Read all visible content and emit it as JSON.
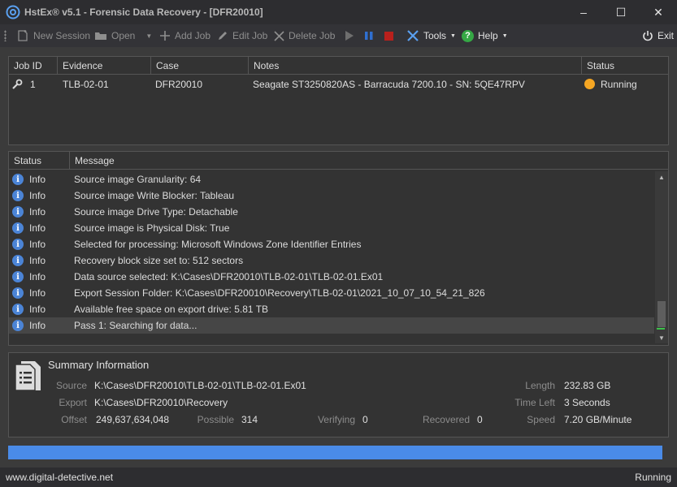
{
  "window": {
    "title": "HstEx® v5.1 - Forensic Data Recovery - [DFR20010]",
    "controls": {
      "minimize": "–",
      "maximize": "☐",
      "close": "✕"
    }
  },
  "toolbar": {
    "new_session": "New Session",
    "open": "Open",
    "add_job": "Add Job",
    "edit_job": "Edit Job",
    "delete_job": "Delete Job",
    "tools": "Tools",
    "help": "Help",
    "exit": "Exit"
  },
  "jobs": {
    "columns": [
      "Job ID",
      "Evidence",
      "Case",
      "Notes",
      "Status"
    ],
    "rows": [
      {
        "id": "1",
        "evidence": "TLB-02-01",
        "case": "DFR20010",
        "notes": "Seagate ST3250820AS - Barracuda 7200.10 - SN: 5QE47RPV",
        "status": "Running",
        "status_color": "#f5a623",
        "icon": "wrench-icon"
      }
    ]
  },
  "log": {
    "columns": [
      "Status",
      "Message"
    ],
    "rows": [
      {
        "status": "Info",
        "message": "Source image Granularity: 64"
      },
      {
        "status": "Info",
        "message": "Source image Write Blocker: Tableau"
      },
      {
        "status": "Info",
        "message": "Source image Drive Type: Detachable"
      },
      {
        "status": "Info",
        "message": "Source image is Physical Disk: True"
      },
      {
        "status": "Info",
        "message": "Selected for processing: Microsoft Windows Zone Identifier Entries"
      },
      {
        "status": "Info",
        "message": "Recovery block size set to: 512 sectors"
      },
      {
        "status": "Info",
        "message": "Data source selected: K:\\Cases\\DFR20010\\TLB-02-01\\TLB-02-01.Ex01"
      },
      {
        "status": "Info",
        "message": "Export Session Folder: K:\\Cases\\DFR20010\\Recovery\\TLB-02-01\\2021_10_07_10_54_21_826"
      },
      {
        "status": "Info",
        "message": "Available free space on export drive: 5.81 TB"
      },
      {
        "status": "Info",
        "message": "Pass 1: Searching for data..."
      }
    ]
  },
  "summary": {
    "title": "Summary Information",
    "source_label": "Source",
    "source": "K:\\Cases\\DFR20010\\TLB-02-01\\TLB-02-01.Ex01",
    "export_label": "Export",
    "export": "K:\\Cases\\DFR20010\\Recovery",
    "offset_label": "Offset",
    "offset": "249,637,634,048",
    "possible_label": "Possible",
    "possible": "314",
    "verifying_label": "Verifying",
    "verifying": "0",
    "recovered_label": "Recovered",
    "recovered": "0",
    "length_label": "Length",
    "length": "232.83 GB",
    "time_left_label": "Time Left",
    "time_left": "3 Seconds",
    "speed_label": "Speed",
    "speed": "7.20 GB/Minute"
  },
  "progress": {
    "fraction": 1.0,
    "color": "#4a8be8"
  },
  "statusbar": {
    "website": "www.digital-detective.net",
    "state": "Running"
  }
}
